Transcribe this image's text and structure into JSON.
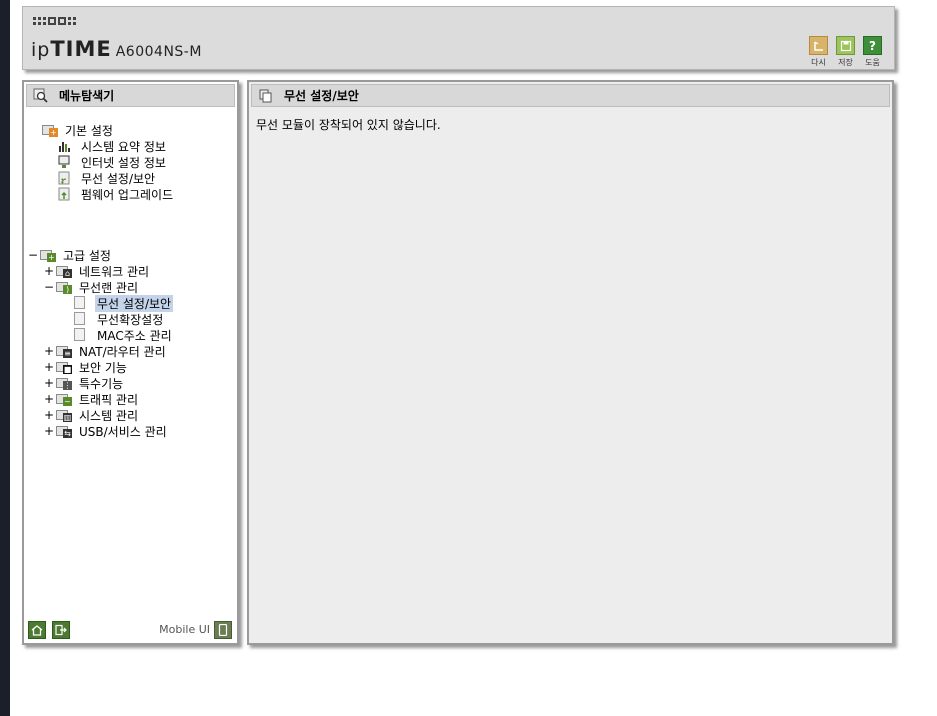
{
  "header": {
    "brand_ip": "ip",
    "brand_time": "TIME",
    "model": "A6004NS-M",
    "buttons": {
      "undo": "다시",
      "save": "저장",
      "help": "도움",
      "help_glyph": "?"
    }
  },
  "left_panel": {
    "title": "메뉴탐색기",
    "basic": {
      "label": "기본 설정",
      "items": [
        "시스템 요약 정보",
        "인터넷 설정 정보",
        "무선 설정/보안",
        "펌웨어 업그레이드"
      ]
    },
    "advanced": {
      "label": "고급 설정",
      "toggle": "−",
      "groups": [
        {
          "toggle": "+",
          "label": "네트워크 관리"
        },
        {
          "toggle": "−",
          "label": "무선랜 관리"
        },
        {
          "toggle": "+",
          "label": "NAT/라우터 관리"
        },
        {
          "toggle": "+",
          "label": "보안 기능"
        },
        {
          "toggle": "+",
          "label": "특수기능"
        },
        {
          "toggle": "+",
          "label": "트래픽 관리"
        },
        {
          "toggle": "+",
          "label": "시스템 관리"
        },
        {
          "toggle": "+",
          "label": "USB/서비스 관리"
        }
      ],
      "wireless_children": [
        "무선 설정/보안",
        "무선확장설정",
        "MAC주소 관리"
      ]
    },
    "footer": {
      "mobile_ui": "Mobile UI"
    }
  },
  "right_panel": {
    "title": "무선 설정/보안",
    "message": "무선 모듈이 장착되어 있지 않습니다."
  },
  "colors": {
    "accent_green": "#4d7a32",
    "selected_bg": "#c3d3ea",
    "panel_header": "#d8d8d8"
  }
}
